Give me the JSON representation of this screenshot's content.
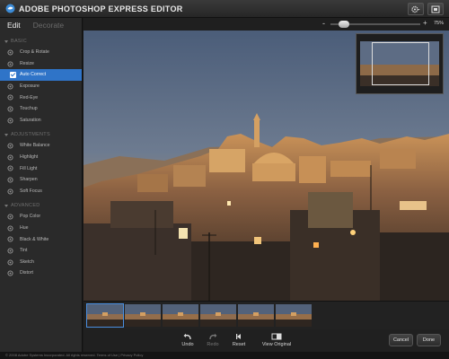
{
  "app": {
    "title": "ADOBE PHOTOSHOP EXPRESS EDITOR"
  },
  "tabs": {
    "edit": "Edit",
    "decorate": "Decorate"
  },
  "sections": [
    {
      "label": "BASIC",
      "items": [
        {
          "label": "Crop & Rotate",
          "icon": "crop-icon"
        },
        {
          "label": "Resize",
          "icon": "resize-icon"
        },
        {
          "label": "Auto Correct",
          "icon": "checkbox-icon",
          "selected": true
        },
        {
          "label": "Exposure",
          "icon": "exposure-icon"
        },
        {
          "label": "Red-Eye",
          "icon": "red-eye-icon"
        },
        {
          "label": "Touchup",
          "icon": "touchup-icon"
        },
        {
          "label": "Saturation",
          "icon": "saturation-icon"
        }
      ]
    },
    {
      "label": "ADJUSTMENTS",
      "items": [
        {
          "label": "White Balance",
          "icon": "white-balance-icon"
        },
        {
          "label": "Highlight",
          "icon": "highlight-icon"
        },
        {
          "label": "Fill Light",
          "icon": "fill-light-icon"
        },
        {
          "label": "Sharpen",
          "icon": "sharpen-icon"
        },
        {
          "label": "Soft Focus",
          "icon": "soft-focus-icon"
        }
      ]
    },
    {
      "label": "ADVANCED",
      "items": [
        {
          "label": "Pop Color",
          "icon": "pop-color-icon"
        },
        {
          "label": "Hue",
          "icon": "hue-icon"
        },
        {
          "label": "Black & White",
          "icon": "black-white-icon"
        },
        {
          "label": "Tint",
          "icon": "tint-icon"
        },
        {
          "label": "Sketch",
          "icon": "sketch-icon"
        },
        {
          "label": "Distort",
          "icon": "distort-icon"
        }
      ]
    }
  ],
  "zoom": {
    "minus": "-",
    "plus": "+",
    "value": "75%",
    "level": 0.12
  },
  "filmstrip": {
    "count": 6,
    "selected_index": 0
  },
  "toolbar": {
    "undo": "Undo",
    "redo": "Redo",
    "reset": "Reset",
    "view_original": "View Original",
    "cancel": "Cancel",
    "done": "Done"
  },
  "footer": {
    "text": "© 2008 Adobe Systems Incorporated. All rights reserved.   Terms of Use  |  Privacy Policy"
  },
  "colors": {
    "accent": "#2f74c8",
    "panel": "#2a2a2a",
    "background": "#1b1b1b"
  }
}
